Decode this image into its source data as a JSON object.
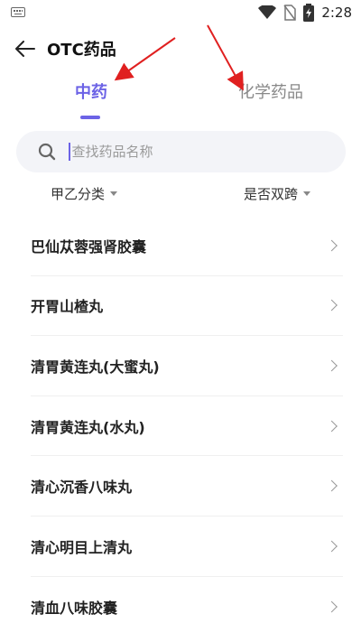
{
  "status_bar": {
    "time": "2:28",
    "icons": [
      "keyboard-icon",
      "wifi-icon",
      "no-sim-icon",
      "battery-charging-icon"
    ]
  },
  "header": {
    "title": "OTC药品",
    "back_icon": "arrow-left-icon"
  },
  "tabs": [
    {
      "label": "中药",
      "active": true
    },
    {
      "label": "化学药品",
      "active": false
    }
  ],
  "search": {
    "placeholder": "查找药品名称",
    "value": ""
  },
  "filters": {
    "left": "甲乙分类",
    "right": "是否双跨"
  },
  "list_items": [
    "巴仙苁蓉强肾胶囊",
    "开胃山楂丸",
    "清胃黄连丸(大蜜丸)",
    "清胃黄连丸(水丸)",
    "清心沉香八味丸",
    "清心明目上清丸",
    "清血八味胶囊"
  ],
  "colors": {
    "accent": "#6c63e6",
    "annotation": "#e02020"
  }
}
